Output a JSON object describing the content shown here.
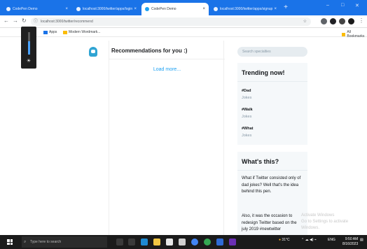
{
  "browser": {
    "tabs": [
      {
        "label": "CodePen Demo"
      },
      {
        "label": "localhost:3000/twitter/apps/login"
      },
      {
        "label": "CodePen Demo"
      },
      {
        "label": "localhost:3000/twitter/apps/signup"
      }
    ],
    "new_tab": "+",
    "url": "localhost:3000/twitter/recommend",
    "bookmarks": [
      {
        "label": "Apps"
      },
      {
        "label": "Modern Wordmark..."
      }
    ],
    "all_bookmarks": "All Bookmarks"
  },
  "page": {
    "feed_title": "Recommendations for you :)",
    "load_more": "Load more...",
    "search_placeholder": "Search specialties",
    "trending": {
      "title": "Trending now!",
      "items": [
        {
          "tag": "#Dad",
          "sub": "Jokes"
        },
        {
          "tag": "#Walk",
          "sub": "Jokes"
        },
        {
          "tag": "#What",
          "sub": "Jokes"
        }
      ]
    },
    "about": {
      "title": "What's this?",
      "para1": "What if Twitter consisted only of dad jokes? Well that's the idea behind this pen.",
      "para2": "Also, it was the occasion to redesign Twitter based on the july 2019 #newtwitter"
    },
    "watermark_line1": "Activate Windows",
    "watermark_line2": "Go to Settings to activate Windows."
  },
  "brightness": {
    "level": 0.6
  },
  "taskbar": {
    "search_placeholder": "Type here to search",
    "weather": "31°C",
    "lang": "ENG",
    "time": "9:50 AM",
    "date": "8/16/2023"
  },
  "colors": {
    "accent": "#1da1f2",
    "chrome": "#1a73e8",
    "taskbar": "#1b1b1b"
  }
}
